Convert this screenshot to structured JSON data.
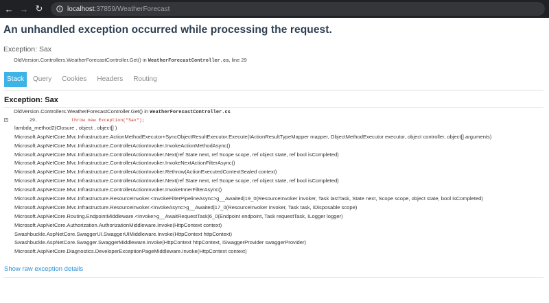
{
  "browser": {
    "url_host": "localhost",
    "url_rest": ":37859/WeatherForecast"
  },
  "error": {
    "title": "An unhandled exception occurred while processing the request.",
    "exception": "Exception: Sax",
    "location_method": "OldVersion.Controllers.WeatherForecastController.Get() in ",
    "location_file": "WeatherForecastController.cs",
    "location_line": ", line 29"
  },
  "tabs": [
    {
      "label": "Stack",
      "active": true
    },
    {
      "label": "Query",
      "active": false
    },
    {
      "label": "Cookies",
      "active": false
    },
    {
      "label": "Headers",
      "active": false
    },
    {
      "label": "Routing",
      "active": false
    }
  ],
  "stack": {
    "title": "Exception: Sax",
    "first_frame_method": "OldVersion.Controllers.WeatherForecastController.Get() in ",
    "first_frame_file": "WeatherForecastController.cs",
    "code_line_number": "29.",
    "code_line_text": "throw new Exception(\"Sax\");",
    "expander_glyph": "+",
    "frames": [
      "lambda_method2(Closure , object , object[] )",
      "Microsoft.AspNetCore.Mvc.Infrastructure.ActionMethodExecutor+SyncObjectResultExecutor.Execute(IActionResultTypeMapper mapper, ObjectMethodExecutor executor, object controller, object[] arguments)",
      "Microsoft.AspNetCore.Mvc.Infrastructure.ControllerActionInvoker.InvokeActionMethodAsync()",
      "Microsoft.AspNetCore.Mvc.Infrastructure.ControllerActionInvoker.Next(ref State next, ref Scope scope, ref object state, ref bool isCompleted)",
      "Microsoft.AspNetCore.Mvc.Infrastructure.ControllerActionInvoker.InvokeNextActionFilterAsync()",
      "Microsoft.AspNetCore.Mvc.Infrastructure.ControllerActionInvoker.Rethrow(ActionExecutedContextSealed context)",
      "Microsoft.AspNetCore.Mvc.Infrastructure.ControllerActionInvoker.Next(ref State next, ref Scope scope, ref object state, ref bool isCompleted)",
      "Microsoft.AspNetCore.Mvc.Infrastructure.ControllerActionInvoker.InvokeInnerFilterAsync()",
      "Microsoft.AspNetCore.Mvc.Infrastructure.ResourceInvoker.<InvokeFilterPipelineAsync>g__Awaited|19_0(ResourceInvoker invoker, Task lastTask, State next, Scope scope, object state, bool isCompleted)",
      "Microsoft.AspNetCore.Mvc.Infrastructure.ResourceInvoker.<InvokeAsync>g__Awaited|17_0(ResourceInvoker invoker, Task task, IDisposable scope)",
      "Microsoft.AspNetCore.Routing.EndpointMiddleware.<Invoke>g__AwaitRequestTask|6_0(Endpoint endpoint, Task requestTask, ILogger logger)",
      "Microsoft.AspNetCore.Authorization.AuthorizationMiddleware.Invoke(HttpContext context)",
      "Swashbuckle.AspNetCore.SwaggerUI.SwaggerUIMiddleware.Invoke(HttpContext httpContext)",
      "Swashbuckle.AspNetCore.Swagger.SwaggerMiddleware.Invoke(HttpContext httpContext, ISwaggerProvider swaggerProvider)",
      "Microsoft.AspNetCore.Diagnostics.DeveloperExceptionPageMiddleware.Invoke(HttpContext context)"
    ]
  },
  "raw_link": "Show raw exception details",
  "colors": {
    "accent_tab": "#3cb4e6",
    "link": "#2a8fd6",
    "code_red": "#c0392b",
    "title": "#2c3e50"
  }
}
